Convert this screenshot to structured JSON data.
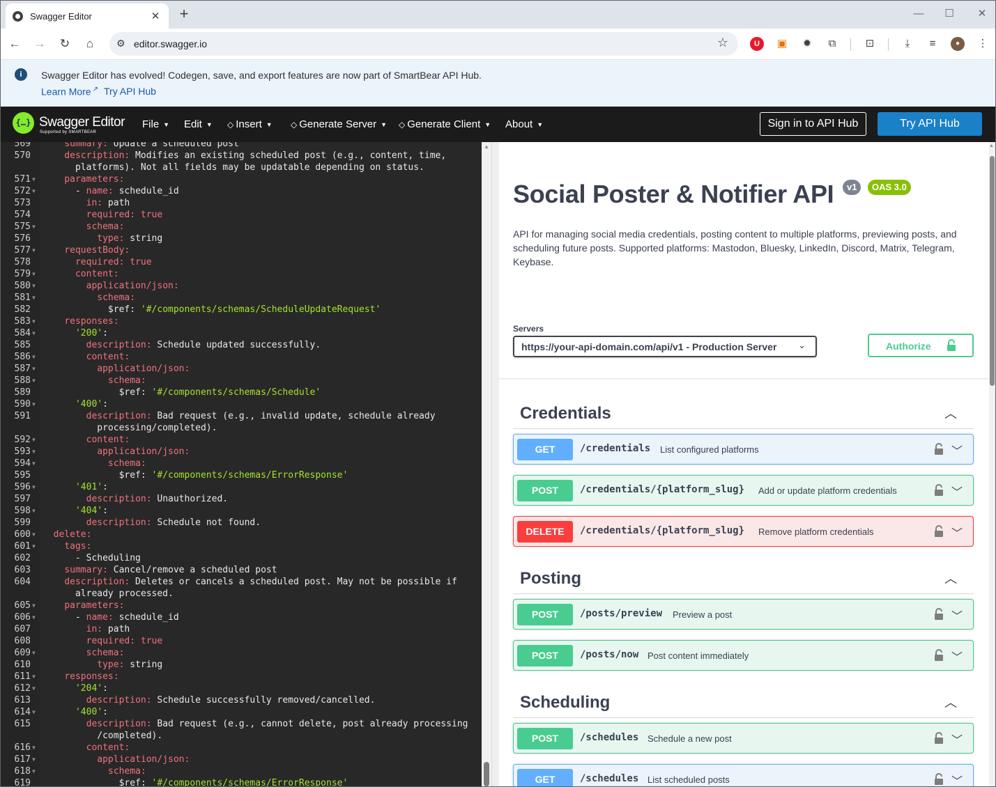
{
  "browser": {
    "tab_title": "Swagger Editor",
    "close_glyph": "✕",
    "new_tab_glyph": "+",
    "url": "editor.swagger.io",
    "window_controls": [
      "—",
      "☐",
      "✕"
    ]
  },
  "banner": {
    "message": "Swagger Editor has evolved! Codegen, save, and export features are now part of SmartBear API Hub.",
    "learn_more": "Learn More",
    "try_api_hub": "Try API Hub"
  },
  "topbar": {
    "brand": "Swagger Editor",
    "brand_sub": "Supported by SMARTBEAR",
    "menus": {
      "file": "File",
      "edit": "Edit",
      "insert": "Insert",
      "generate_server": "Generate Server",
      "generate_client": "Generate Client",
      "about": "About"
    },
    "sign_in": "Sign in to API Hub",
    "try_api_hub": "Try API Hub"
  },
  "editor": {
    "lines": [
      {
        "n": "569",
        "html": "    <span class=\"k\">summary:</span> Update a scheduled post"
      },
      {
        "n": "570",
        "html": "    <span class=\"k\">description:</span> Modifies an existing scheduled post (e.g., content, time,"
      },
      {
        "n": "",
        "html": "      platforms). Not all fields may be updatable depending on status."
      },
      {
        "n": "571",
        "fold": true,
        "html": "    <span class=\"k\">parameters:</span>"
      },
      {
        "n": "572",
        "fold": true,
        "html": "      - <span class=\"k\">name:</span> schedule_id"
      },
      {
        "n": "573",
        "html": "        <span class=\"k\">in:</span> path"
      },
      {
        "n": "574",
        "html": "        <span class=\"k\">required:</span> <span class=\"bool\">true</span>"
      },
      {
        "n": "575",
        "fold": true,
        "html": "        <span class=\"k\">schema:</span>"
      },
      {
        "n": "576",
        "html": "          <span class=\"k\">type:</span> string"
      },
      {
        "n": "577",
        "fold": true,
        "html": "    <span class=\"k\">requestBody:</span>"
      },
      {
        "n": "578",
        "html": "      <span class=\"k\">required:</span> <span class=\"bool\">true</span>"
      },
      {
        "n": "579",
        "fold": true,
        "html": "      <span class=\"k\">content:</span>"
      },
      {
        "n": "580",
        "fold": true,
        "html": "        <span class=\"k\">application/json:</span>"
      },
      {
        "n": "581",
        "fold": true,
        "html": "          <span class=\"k\">schema:</span>"
      },
      {
        "n": "582",
        "html": "            $ref: <span class=\"s\">'#/components/schemas/ScheduleUpdateRequest'</span>"
      },
      {
        "n": "583",
        "fold": true,
        "html": "    <span class=\"k\">responses:</span>"
      },
      {
        "n": "584",
        "fold": true,
        "html": "      <span class=\"s\">'200'</span>:"
      },
      {
        "n": "585",
        "html": "        <span class=\"k\">description:</span> Schedule updated successfully."
      },
      {
        "n": "586",
        "fold": true,
        "html": "        <span class=\"k\">content:</span>"
      },
      {
        "n": "587",
        "fold": true,
        "html": "          <span class=\"k\">application/json:</span>"
      },
      {
        "n": "588",
        "fold": true,
        "html": "            <span class=\"k\">schema:</span>"
      },
      {
        "n": "589",
        "html": "              $ref: <span class=\"s\">'#/components/schemas/Schedule'</span>"
      },
      {
        "n": "590",
        "fold": true,
        "html": "      <span class=\"s\">'400'</span>:"
      },
      {
        "n": "591",
        "html": "        <span class=\"k\">description:</span> Bad request (e.g., invalid update, schedule already"
      },
      {
        "n": "",
        "html": "          processing/completed)."
      },
      {
        "n": "592",
        "fold": true,
        "html": "        <span class=\"k\">content:</span>"
      },
      {
        "n": "593",
        "fold": true,
        "html": "          <span class=\"k\">application/json:</span>"
      },
      {
        "n": "594",
        "fold": true,
        "html": "            <span class=\"k\">schema:</span>"
      },
      {
        "n": "595",
        "html": "              $ref: <span class=\"s\">'#/components/schemas/ErrorResponse'</span>"
      },
      {
        "n": "596",
        "fold": true,
        "html": "      <span class=\"s\">'401'</span>:"
      },
      {
        "n": "597",
        "html": "        <span class=\"k\">description:</span> Unauthorized."
      },
      {
        "n": "598",
        "fold": true,
        "html": "      <span class=\"s\">'404'</span>:"
      },
      {
        "n": "599",
        "html": "        <span class=\"k\">description:</span> Schedule not found."
      },
      {
        "n": "600",
        "fold": true,
        "html": "  <span class=\"k\">delete:</span>"
      },
      {
        "n": "601",
        "fold": true,
        "html": "    <span class=\"k\">tags:</span>"
      },
      {
        "n": "602",
        "html": "      - Scheduling"
      },
      {
        "n": "603",
        "html": "    <span class=\"k\">summary:</span> Cancel/remove a scheduled post"
      },
      {
        "n": "604",
        "html": "    <span class=\"k\">description:</span> Deletes or cancels a scheduled post. May not be possible if"
      },
      {
        "n": "",
        "html": "      already processed."
      },
      {
        "n": "605",
        "fold": true,
        "html": "    <span class=\"k\">parameters:</span>"
      },
      {
        "n": "606",
        "fold": true,
        "html": "      - <span class=\"k\">name:</span> schedule_id"
      },
      {
        "n": "607",
        "html": "        <span class=\"k\">in:</span> path"
      },
      {
        "n": "608",
        "html": "        <span class=\"k\">required:</span> <span class=\"bool\">true</span>"
      },
      {
        "n": "609",
        "fold": true,
        "html": "        <span class=\"k\">schema:</span>"
      },
      {
        "n": "610",
        "html": "          <span class=\"k\">type:</span> string"
      },
      {
        "n": "611",
        "fold": true,
        "html": "    <span class=\"k\">responses:</span>"
      },
      {
        "n": "612",
        "fold": true,
        "html": "      <span class=\"s\">'204'</span>:"
      },
      {
        "n": "613",
        "html": "        <span class=\"k\">description:</span> Schedule successfully removed/cancelled."
      },
      {
        "n": "614",
        "fold": true,
        "html": "      <span class=\"s\">'400'</span>:"
      },
      {
        "n": "615",
        "html": "        <span class=\"k\">description:</span> Bad request (e.g., cannot delete, post already processing"
      },
      {
        "n": "",
        "html": "          /completed)."
      },
      {
        "n": "616",
        "fold": true,
        "html": "        <span class=\"k\">content:</span>"
      },
      {
        "n": "617",
        "fold": true,
        "html": "          <span class=\"k\">application/json:</span>"
      },
      {
        "n": "618",
        "fold": true,
        "html": "            <span class=\"k\">schema:</span>"
      },
      {
        "n": "619",
        "html": "              $ref: <span class=\"s\">'#/components/schemas/ErrorResponse'</span>"
      }
    ]
  },
  "info": {
    "title": "Social Poster & Notifier API",
    "version_badge": "v1",
    "oas_badge": "OAS 3.0",
    "description": "API for managing social media credentials, posting content to multiple platforms, previewing posts, and scheduling future posts. Supported platforms: Mastodon, Bluesky, LinkedIn, Discord, Matrix, Telegram, Keybase."
  },
  "servers": {
    "label": "Servers",
    "selected": "https://your-api-domain.com/api/v1 - Production Server"
  },
  "authorize_label": "Authorize",
  "tags": {
    "credentials": "Credentials",
    "posting": "Posting",
    "scheduling": "Scheduling"
  },
  "operations": {
    "get_credentials": {
      "method": "GET",
      "path": "/credentials",
      "summary": "List configured platforms"
    },
    "post_credentials": {
      "method": "POST",
      "path": "/credentials/{platform_slug}",
      "summary": "Add or update platform credentials"
    },
    "delete_credentials": {
      "method": "DELETE",
      "path": "/credentials/{platform_slug}",
      "summary": "Remove platform credentials"
    },
    "post_preview": {
      "method": "POST",
      "path": "/posts/preview",
      "summary": "Preview a post"
    },
    "post_now": {
      "method": "POST",
      "path": "/posts/now",
      "summary": "Post content immediately"
    },
    "post_schedules": {
      "method": "POST",
      "path": "/schedules",
      "summary": "Schedule a new post"
    },
    "get_schedules": {
      "method": "GET",
      "path": "/schedules",
      "summary": "List scheduled posts"
    }
  },
  "colors": {
    "get": "#61affe",
    "post": "#49cc90",
    "delete": "#f93e3e",
    "topbar": "#1b1b1b",
    "editor_bg": "#282828",
    "yaml_key": "#f0727e",
    "yaml_string": "#a6e22e"
  }
}
